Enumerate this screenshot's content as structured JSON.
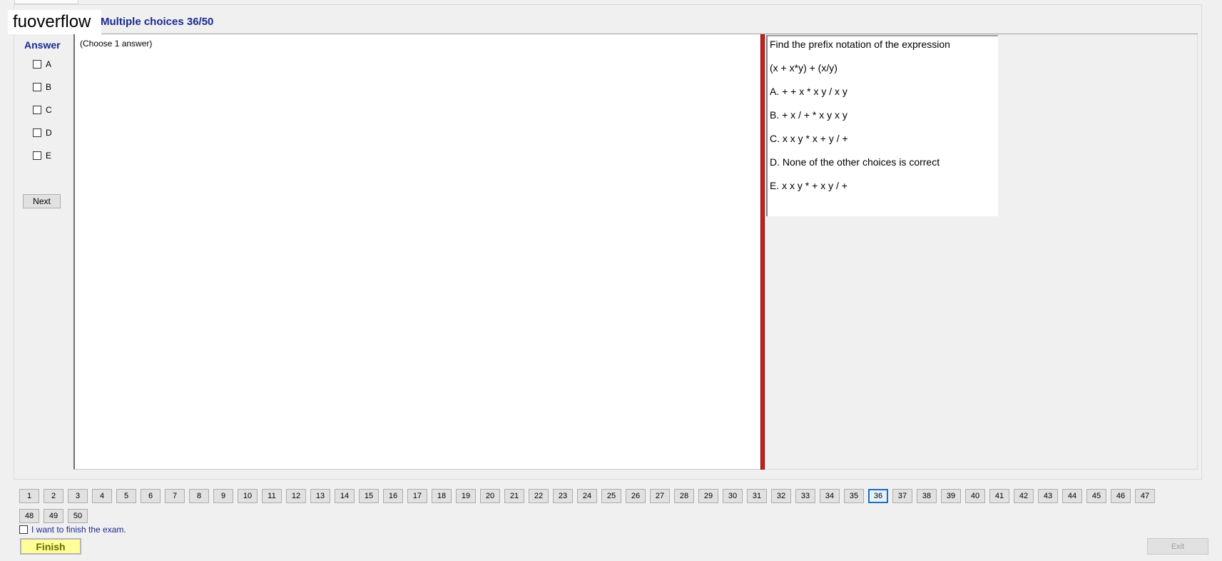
{
  "watermark": "fuoverflow",
  "header": {
    "title": "Multiple choices 36/50"
  },
  "answer": {
    "heading": "Answer",
    "options": [
      "A",
      "B",
      "C",
      "D",
      "E"
    ],
    "next_label": "Next",
    "instruction": "(Choose 1 answer)"
  },
  "question": {
    "lines": [
      "Find the prefix notation of the expression",
      "(x + x*y) + (x/y)",
      "A.  + + x * x y / x y",
      "B.  + x / + * x y x y",
      "C.  x x y * x + y / +",
      "D.  None of the other choices is correct",
      "E.  x x y * + x y / +"
    ]
  },
  "navigation": {
    "current": 36,
    "row1": [
      "1",
      "2",
      "3",
      "4",
      "5",
      "6",
      "7",
      "8",
      "9",
      "10",
      "11",
      "12",
      "13",
      "14",
      "15",
      "16",
      "17",
      "18",
      "19",
      "20",
      "21",
      "22",
      "23",
      "24",
      "25",
      "26",
      "27",
      "28",
      "29",
      "30",
      "31",
      "32",
      "33",
      "34",
      "35",
      "36",
      "37",
      "38",
      "39",
      "40",
      "41",
      "42",
      "43",
      "44",
      "45",
      "46",
      "47"
    ],
    "row2": [
      "48",
      "49",
      "50"
    ]
  },
  "footer": {
    "finish_check_label": "I want to finish the exam.",
    "finish_label": "Finish",
    "exit_label": "Exit"
  }
}
